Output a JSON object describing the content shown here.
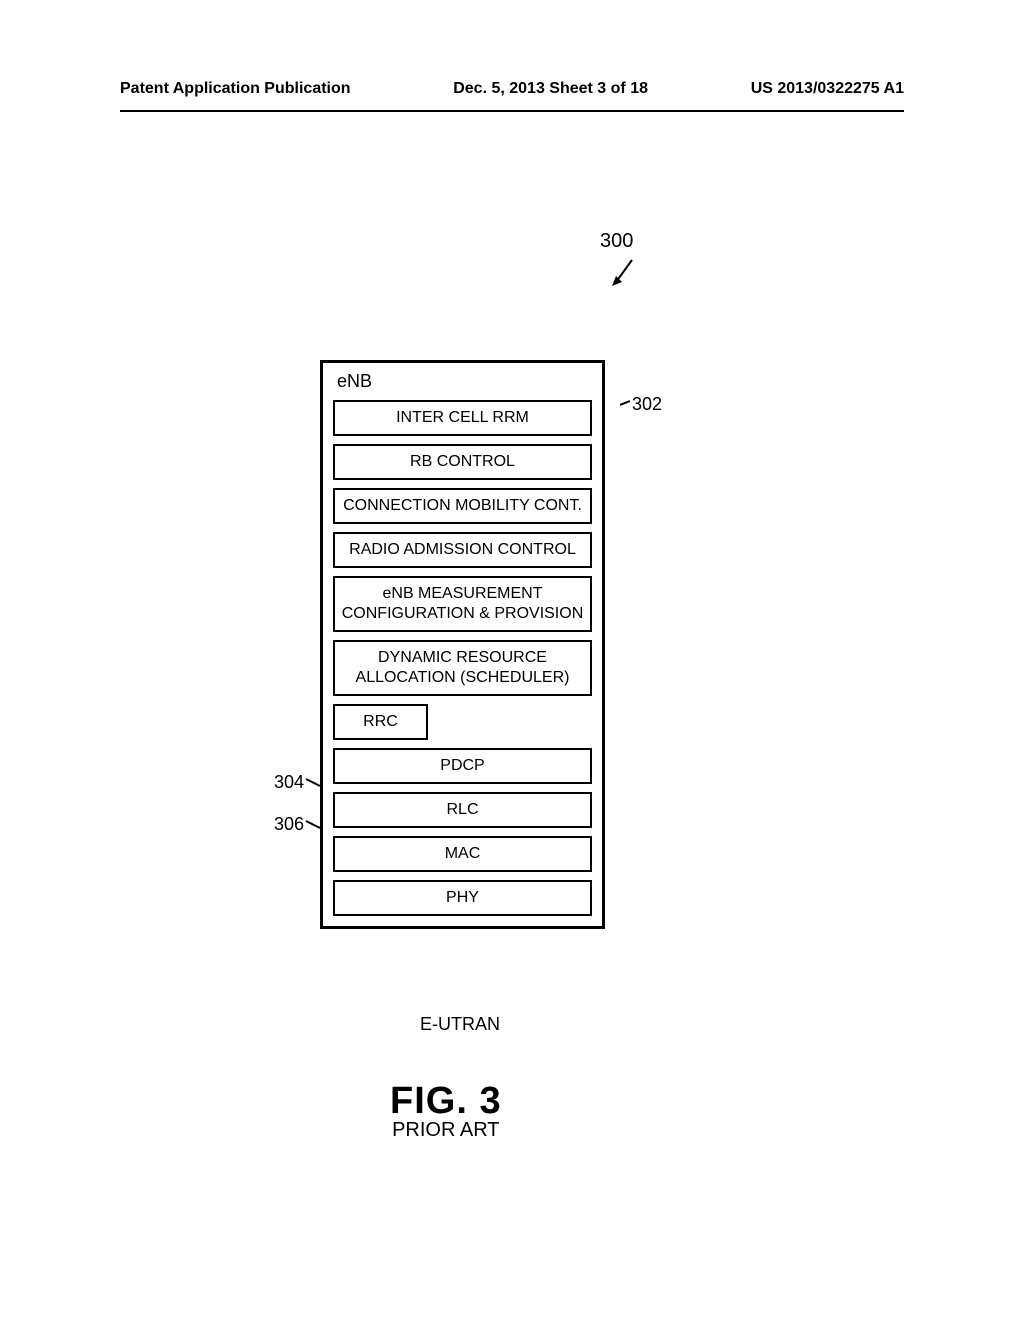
{
  "header": {
    "left": "Patent Application Publication",
    "center": "Dec. 5, 2013  Sheet 3 of 18",
    "right": "US 2013/0322275 A1"
  },
  "refs": {
    "r300": "300",
    "r302": "302",
    "r304": "304",
    "r306": "306"
  },
  "diagram": {
    "enb_label": "eNB",
    "boxes": {
      "inter_cell_rrm": "INTER CELL RRM",
      "rb_control": "RB CONTROL",
      "conn_mobility": "CONNECTION MOBILITY CONT.",
      "radio_admission": "RADIO ADMISSION CONTROL",
      "enb_measurement": "eNB MEASUREMENT CONFIGURATION & PROVISION",
      "dynamic_resource": "DYNAMIC RESOURCE ALLOCATION (SCHEDULER)",
      "rrc": "RRC",
      "pdcp": "PDCP",
      "rlc": "RLC",
      "mac": "MAC",
      "phy": "PHY"
    },
    "eutran": "E-UTRAN"
  },
  "figure": {
    "title": "FIG. 3",
    "subtitle": "PRIOR ART"
  }
}
